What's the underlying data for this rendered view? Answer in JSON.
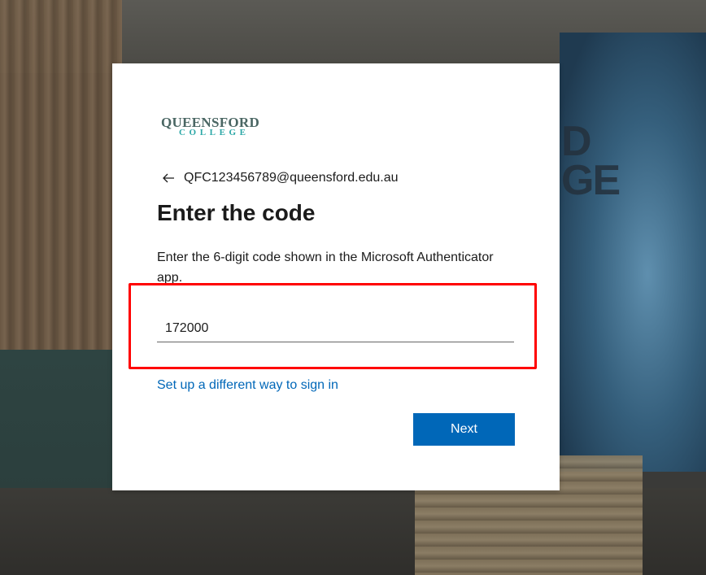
{
  "logo": {
    "line1": "QUEENSFORD",
    "line2": "COLLEGE"
  },
  "identity": {
    "back_icon": "arrow-left-icon",
    "email": "QFC123456789@queensford.edu.au"
  },
  "title": "Enter the code",
  "description": "Enter the 6-digit code shown in the Microsoft Authenticator app.",
  "code_input": {
    "value": "172000",
    "placeholder": ""
  },
  "alt_link": "Set up a different way to sign in",
  "next_button": "Next",
  "colors": {
    "accent": "#0067b8",
    "highlight": "#ff0000",
    "logo_primary": "#4a6663",
    "logo_secondary": "#2aa7a6"
  },
  "background": {
    "mural_text": "D\nGE"
  }
}
